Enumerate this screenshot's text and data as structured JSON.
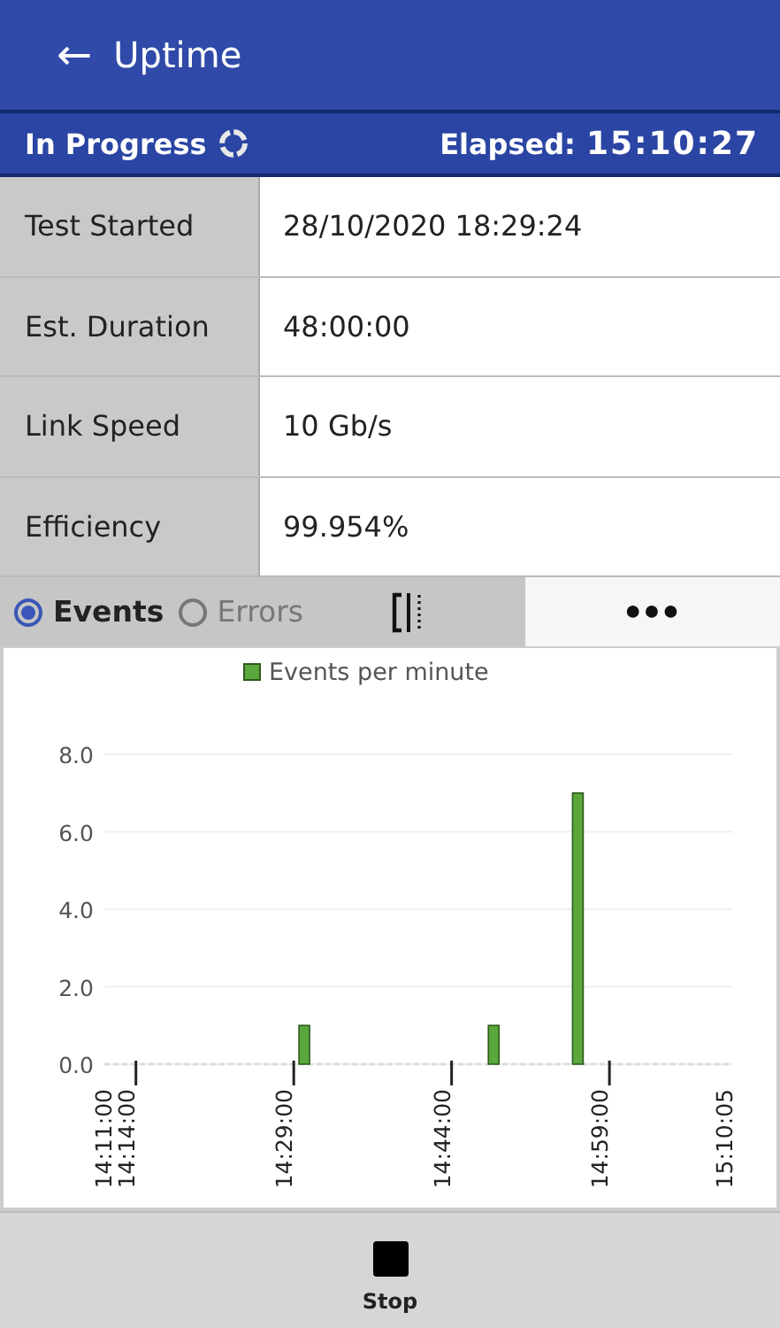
{
  "app_bar": {
    "back_icon": "←",
    "title": "Uptime"
  },
  "status_bar": {
    "status": "In Progress",
    "elapsed_label": "Elapsed:",
    "elapsed": "15:10:27"
  },
  "details": [
    {
      "label": "Test Started",
      "value": "28/10/2020 18:29:24"
    },
    {
      "label": "Est. Duration",
      "value": "48:00:00"
    },
    {
      "label": "Link Speed",
      "value": "10 Gb/s"
    },
    {
      "label": "Efficiency",
      "value": "99.954%"
    }
  ],
  "view_options": [
    {
      "label": "Events",
      "selected": true
    },
    {
      "label": "Errors",
      "selected": false
    }
  ],
  "more_button": "●●●",
  "chart": {
    "chart_data": {
      "type": "bar",
      "categories": [
        "14:11:00",
        null,
        null,
        "14:14:00",
        null,
        null,
        null,
        null,
        null,
        null,
        null,
        null,
        null,
        null,
        null,
        null,
        null,
        null,
        "14:29:00",
        null,
        null,
        null,
        null,
        null,
        null,
        null,
        null,
        null,
        null,
        null,
        null,
        null,
        null,
        "14:44:00",
        null,
        null,
        null,
        null,
        null,
        null,
        null,
        null,
        null,
        null,
        null,
        null,
        null,
        null,
        "14:59:00",
        null,
        null,
        null,
        null,
        null,
        null,
        null,
        null,
        null,
        null,
        "15:10:05"
      ],
      "series": [
        {
          "name": "Events per minute",
          "color": "#5aa83c",
          "values": [
            null,
            null,
            null,
            null,
            null,
            null,
            null,
            null,
            null,
            null,
            null,
            null,
            null,
            null,
            null,
            null,
            null,
            null,
            null,
            1,
            null,
            null,
            null,
            null,
            null,
            null,
            null,
            null,
            null,
            null,
            null,
            null,
            null,
            null,
            null,
            null,
            null,
            1,
            null,
            null,
            null,
            null,
            null,
            null,
            null,
            7,
            null,
            null,
            null,
            null,
            null,
            null,
            null,
            null,
            null,
            null,
            null,
            null,
            null,
            null
          ]
        }
      ],
      "ylim": [
        0,
        8
      ],
      "grid": true,
      "yticks": [
        {
          "value": 0,
          "label": "0.0"
        },
        {
          "value": 2,
          "label": "2.0"
        },
        {
          "value": 4,
          "label": "4.0"
        },
        {
          "value": 6,
          "label": "6.0"
        },
        {
          "value": 8,
          "label": "8.0"
        }
      ]
    }
  },
  "stop_button": "Stop"
}
